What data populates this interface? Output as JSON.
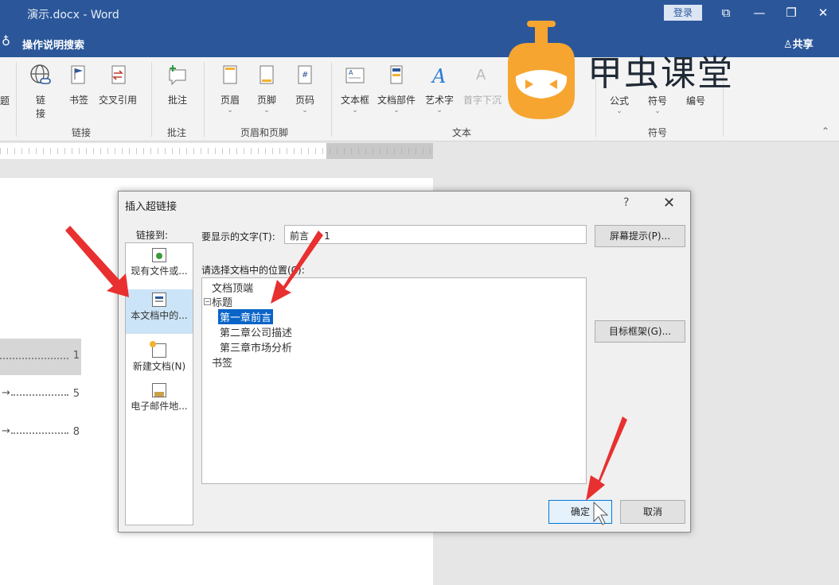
{
  "window": {
    "title": "演示.docx - Word",
    "login": "登录",
    "controls": {
      "ribbon_options": "⧉",
      "minimize": "—",
      "restore": "❐",
      "close": "✕"
    }
  },
  "tellbar": {
    "tell_me": "操作说明搜索",
    "share": "共享"
  },
  "ribbon": {
    "partial_left": "题",
    "links": {
      "hyperlink": "链",
      "hyperlink2": "接",
      "bookmark": "书签",
      "crossref": "交叉引用",
      "group": "链接"
    },
    "comments": {
      "comment": "批注",
      "group": "批注"
    },
    "headerfooter": {
      "header": "页眉",
      "footer": "页脚",
      "pagenum": "页码",
      "group": "页眉和页脚"
    },
    "text": {
      "textbox": "文本框",
      "quickparts": "文档部件",
      "wordart": "艺术字",
      "dropcap": "首字下沉",
      "group": "文本"
    },
    "symbols": {
      "equation": "公式",
      "symbol": "符号",
      "number": "编号",
      "group": "符号"
    }
  },
  "document": {
    "toc": [
      {
        "num": "1",
        "prefix": ""
      },
      {
        "num": "5",
        "prefix": "→"
      },
      {
        "num": "8",
        "prefix": "→"
      }
    ]
  },
  "dialog": {
    "title": "插入超链接",
    "help": "?",
    "close": "✕",
    "link_to_label": "链接到:",
    "link_to": [
      {
        "label": "现有文件或..."
      },
      {
        "label": "本文档中的..."
      },
      {
        "label": "新建文档(N)"
      },
      {
        "label": "电子邮件地..."
      }
    ],
    "display_text_label": "要显示的文字(T):",
    "display_text_value": "前言     1",
    "screen_tip": "屏幕提示(P)...",
    "position_label": "请选择文档中的位置(C):",
    "tree": {
      "top": "文档顶端",
      "headings": "标题",
      "items": [
        "第一章前言",
        "第二章公司描述",
        "第三章市场分析"
      ],
      "bookmarks": "书签"
    },
    "target_frame": "目标框架(G)...",
    "ok": "确定",
    "cancel": "取消"
  },
  "watermark": {
    "text": "甲虫课堂"
  },
  "colors": {
    "accent": "#2b579a",
    "selection": "#0a64c8",
    "arrow": "#e83030",
    "logo": "#f7a531"
  }
}
